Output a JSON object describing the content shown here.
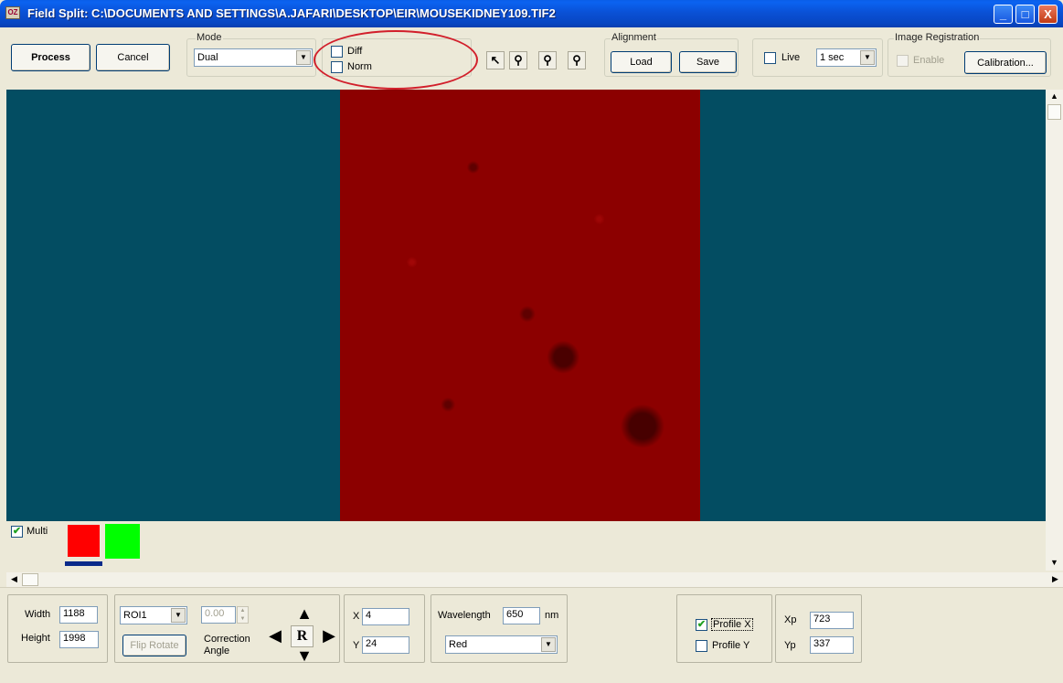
{
  "window": {
    "title": "Field Split: C:\\DOCUMENTS AND SETTINGS\\A.JAFARI\\DESKTOP\\EIR\\MOUSEKIDNEY109.TIF2",
    "app_icon_text": "OZ",
    "minimize_glyph": "_",
    "maximize_glyph": "□",
    "close_glyph": "X"
  },
  "toolbar": {
    "process_label": "Process",
    "cancel_label": "Cancel",
    "mode": {
      "legend": "Mode",
      "value": "Dual"
    },
    "diff_label": "Diff",
    "norm_label": "Norm",
    "tools": [
      "pointer-icon",
      "zoom-icon",
      "zoom-in-icon",
      "zoom-out-icon"
    ],
    "alignment": {
      "legend": "Alignment",
      "load_label": "Load",
      "save_label": "Save"
    },
    "live": {
      "label": "Live",
      "interval": "1 sec"
    },
    "registration": {
      "legend": "Image Registration",
      "enable_label": "Enable",
      "calibration_label": "Calibration..."
    }
  },
  "annotation_color": "#d21f2b",
  "multi": {
    "label": "Multi",
    "checked": true,
    "swatches": [
      "#ff0000",
      "#00ff00"
    ]
  },
  "bottom": {
    "width_label": "Width",
    "width_value": "1188",
    "height_label": "Height",
    "height_value": "1998",
    "roi_value": "ROI1",
    "flip_rotate_label": "Flip Rotate",
    "angle_value": "0.00",
    "correction_label": "Correction",
    "angle_label": "Angle",
    "r_label": "R",
    "x_label": "X",
    "x_value": "4",
    "y_label": "Y",
    "y_value": "24",
    "wavelength_label": "Wavelength",
    "wavelength_value": "650",
    "wavelength_unit": "nm",
    "color_value": "Red",
    "profile_x_label": "Profile X",
    "profile_x_checked": true,
    "profile_y_label": "Profile Y",
    "profile_y_checked": false,
    "xp_label": "Xp",
    "xp_value": "723",
    "yp_label": "Yp",
    "yp_value": "337"
  }
}
